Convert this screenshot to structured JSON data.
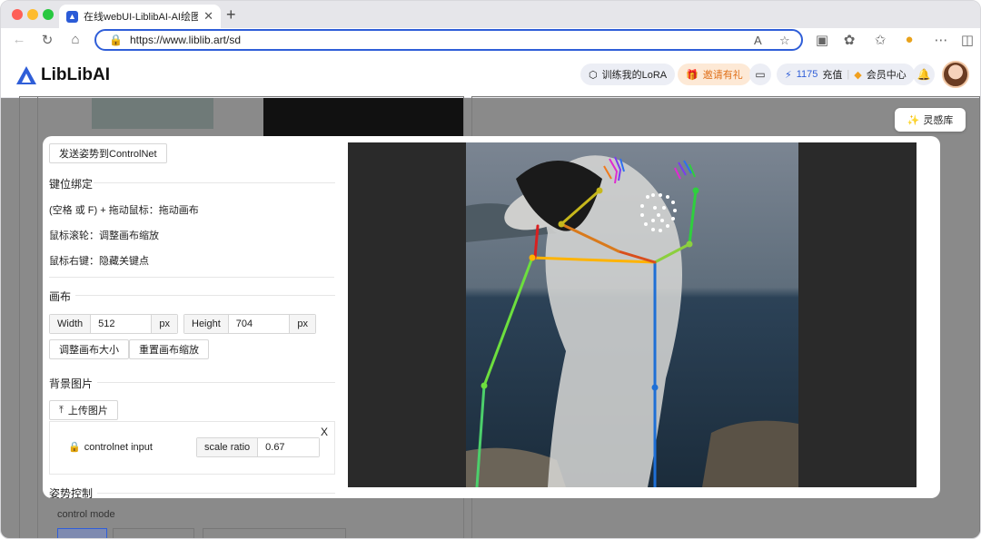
{
  "browser": {
    "tab_title": "在线webUI-LiblibAI-AI绘图工具",
    "tab_close": "✕",
    "new_tab": "+",
    "url": "https://www.liblib.art/sd"
  },
  "site": {
    "logo_text": "LibLibAI",
    "train_lora": "训练我的LoRA",
    "invite": "邀请有礼",
    "credits": "1175",
    "recharge": "充值",
    "member_center": "会员中心",
    "inspiration": "灵感库"
  },
  "background": {
    "control_mode": "control mode"
  },
  "modal": {
    "send_pose_button": "发送姿势到ControlNet",
    "keybind_title": "键位绑定",
    "hint_drag": "(空格 或 F) + 拖动鼠标：拖动画布",
    "hint_scroll": "鼠标滚轮：调整画布缩放",
    "hint_right": "鼠标右键：隐藏关键点",
    "canvas_title": "画布",
    "width_label": "Width",
    "width_value": "512",
    "height_label": "Height",
    "height_value": "704",
    "unit_px": "px",
    "resize_canvas": "调整画布大小",
    "reset_zoom": "重置画布缩放",
    "bg_image_title": "背景图片",
    "upload_image": "上传图片",
    "close_symbol": "X",
    "controlnet_input": "controlnet input",
    "scale_ratio_label": "scale ratio",
    "scale_ratio_value": "0.67",
    "pose_control_title": "姿势控制"
  }
}
